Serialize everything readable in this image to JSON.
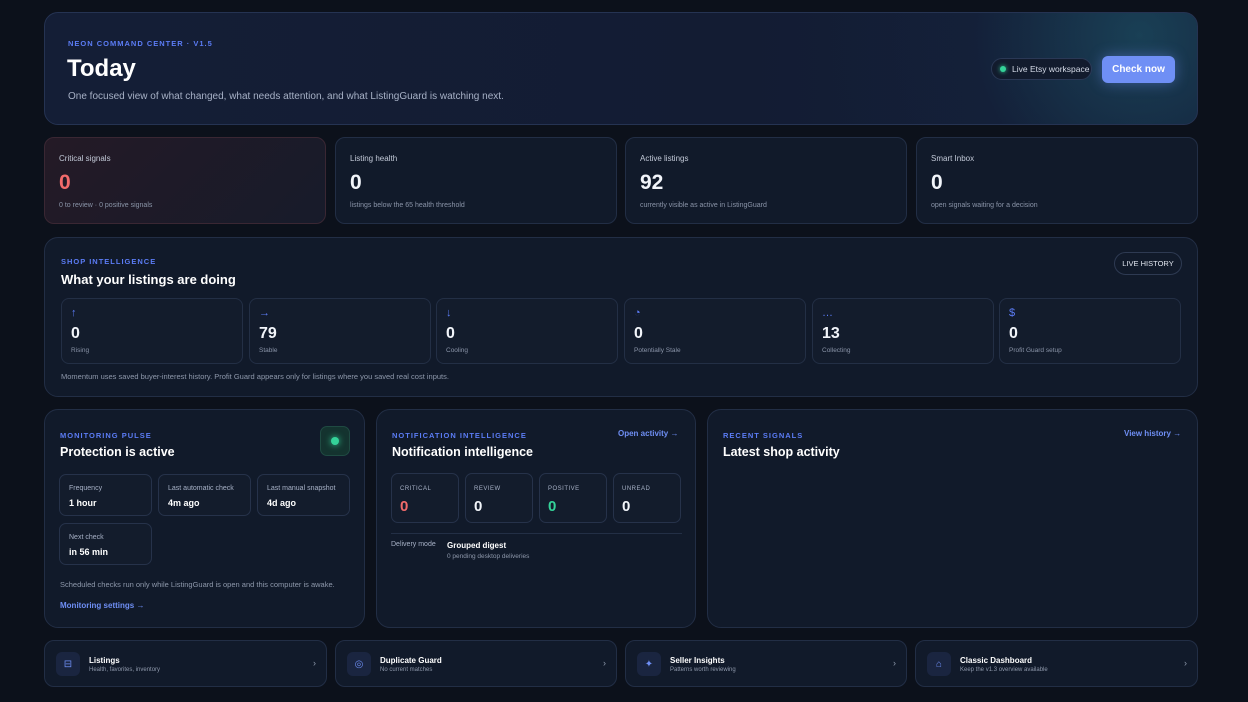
{
  "hero": {
    "eyebrow": "NEON COMMAND CENTER · V1.5",
    "title": "Today",
    "subtitle": "One focused view of what changed, what needs attention, and what ListingGuard is watching next.",
    "workspace": "Live Etsy workspace",
    "check_button": "Check now"
  },
  "stats": [
    {
      "label": "Critical signals",
      "value": "0",
      "desc": "0 to review · 0 positive signals"
    },
    {
      "label": "Listing health",
      "value": "0",
      "desc": "listings below the 65 health threshold"
    },
    {
      "label": "Active listings",
      "value": "92",
      "desc": "currently visible as active in ListingGuard"
    },
    {
      "label": "Smart Inbox",
      "value": "0",
      "desc": "open signals waiting for a decision"
    }
  ],
  "shop": {
    "eyebrow": "SHOP INTELLIGENCE",
    "title": "What your listings are doing",
    "history_button": "LIVE HISTORY",
    "metrics": [
      {
        "icon": "↑",
        "value": "0",
        "label": "Rising"
      },
      {
        "icon": "→",
        "value": "79",
        "label": "Stable"
      },
      {
        "icon": "↓",
        "value": "0",
        "label": "Cooling"
      },
      {
        "icon": "◔",
        "value": "0",
        "label": "Potentially Stale"
      },
      {
        "icon": "…",
        "value": "13",
        "label": "Collecting"
      },
      {
        "icon": "$",
        "value": "0",
        "label": "Profit Guard setup"
      }
    ],
    "footnote": "Momentum uses saved buyer-interest history. Profit Guard appears only for listings where you saved real cost inputs."
  },
  "pulse": {
    "eyebrow": "MONITORING PULSE",
    "title": "Protection is active",
    "boxes": [
      {
        "label": "Frequency",
        "value": "1 hour"
      },
      {
        "label": "Last automatic check",
        "value": "4m ago"
      },
      {
        "label": "Last manual snapshot",
        "value": "4d ago"
      },
      {
        "label": "Next check",
        "value": "in 56 min"
      }
    ],
    "note": "Scheduled checks run only while ListingGuard is open and this computer is awake.",
    "link": "Monitoring settings →"
  },
  "notif": {
    "eyebrow": "NOTIFICATION INTELLIGENCE",
    "title": "Notification intelligence",
    "link": "Open activity →",
    "boxes": [
      {
        "label": "CRITICAL",
        "value": "0",
        "color": "#f26b6b"
      },
      {
        "label": "REVIEW",
        "value": "0",
        "color": "#f2f5fa"
      },
      {
        "label": "POSITIVE",
        "value": "0",
        "color": "#34d399"
      },
      {
        "label": "UNREAD",
        "value": "0",
        "color": "#f2f5fa"
      }
    ],
    "delivery_label": "Delivery mode",
    "delivery_value": "Grouped digest",
    "delivery_sub": "0 pending desktop deliveries"
  },
  "signals": {
    "eyebrow": "RECENT SIGNALS",
    "title": "Latest shop activity",
    "link": "View history →"
  },
  "nav": [
    {
      "icon": "⊟",
      "title": "Listings",
      "sub": "Health, favorites, inventory",
      "arrow": "›"
    },
    {
      "icon": "◎",
      "title": "Duplicate Guard",
      "sub": "No current matches",
      "arrow": "›"
    },
    {
      "icon": "✦",
      "title": "Seller Insights",
      "sub": "Patterns worth reviewing",
      "arrow": "›"
    },
    {
      "icon": "⌂",
      "title": "Classic Dashboard",
      "sub": "Keep the v1.3 overview available",
      "arrow": "›"
    }
  ],
  "colors": {
    "accent": "#6f8ff5",
    "critical": "#f26b6b",
    "positive": "#34d399",
    "background": "#0c111b"
  }
}
